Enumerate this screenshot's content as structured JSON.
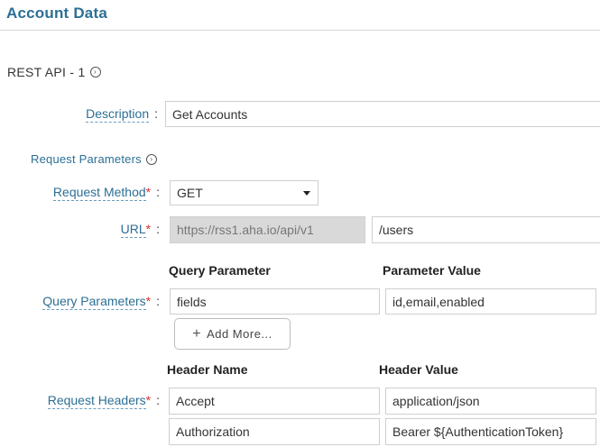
{
  "page_title": "Account Data",
  "section_title": "REST API - 1",
  "description": {
    "label": "Description",
    "value": "Get Accounts"
  },
  "request_parameters_label": "Request Parameters",
  "request_method": {
    "label": "Request Method",
    "value": "GET"
  },
  "url": {
    "label": "URL",
    "base": "https://rss1.aha.io/api/v1",
    "path": "/users"
  },
  "query": {
    "label": "Query Parameters",
    "col_param": "Query Parameter",
    "col_value": "Parameter Value",
    "rows": [
      {
        "param": "fields",
        "value": "id,email,enabled"
      }
    ],
    "add_more": "Add More..."
  },
  "headers": {
    "label": "Request Headers",
    "col_name": "Header Name",
    "col_value": "Header Value",
    "rows": [
      {
        "name": "Accept",
        "value": "application/json"
      },
      {
        "name": "Authorization",
        "value": "Bearer ${AuthenticationToken}"
      }
    ]
  },
  "required_mark": "*",
  "colon": ":",
  "colors": {
    "accent": "#2c6f95",
    "required": "#d9302c",
    "disabled_bg": "#d9d9d9"
  }
}
